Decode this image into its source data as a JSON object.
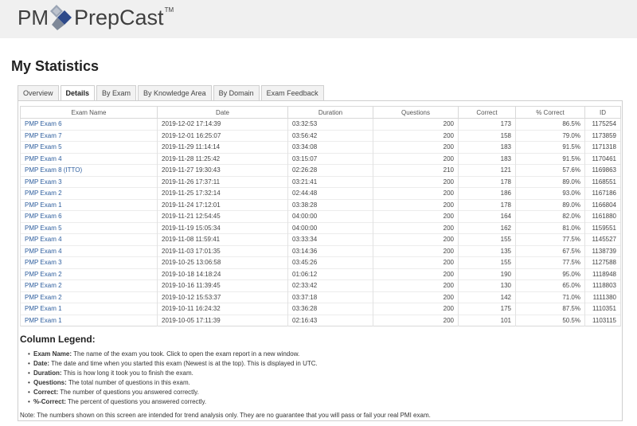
{
  "header": {
    "logo_pm": "PM",
    "logo_prep": "PrepCast",
    "logo_tm": "TM"
  },
  "page_title": "My Statistics",
  "tabs": [
    {
      "label": "Overview",
      "active": false
    },
    {
      "label": "Details",
      "active": true
    },
    {
      "label": "By Exam",
      "active": false
    },
    {
      "label": "By Knowledge Area",
      "active": false
    },
    {
      "label": "By Domain",
      "active": false
    },
    {
      "label": "Exam Feedback",
      "active": false
    }
  ],
  "table": {
    "columns": [
      "Exam Name",
      "Date",
      "Duration",
      "Questions",
      "Correct",
      "% Correct",
      "ID"
    ],
    "rows": [
      [
        "PMP Exam 6",
        "2019-12-02 17:14:39",
        "03:32:53",
        "200",
        "173",
        "86.5%",
        "1175254"
      ],
      [
        "PMP Exam 7",
        "2019-12-01 16:25:07",
        "03:56:42",
        "200",
        "158",
        "79.0%",
        "1173859"
      ],
      [
        "PMP Exam 5",
        "2019-11-29 11:14:14",
        "03:34:08",
        "200",
        "183",
        "91.5%",
        "1171318"
      ],
      [
        "PMP Exam 4",
        "2019-11-28 11:25:42",
        "03:15:07",
        "200",
        "183",
        "91.5%",
        "1170461"
      ],
      [
        "PMP Exam 8 (ITTO)",
        "2019-11-27 19:30:43",
        "02:26:28",
        "210",
        "121",
        "57.6%",
        "1169863"
      ],
      [
        "PMP Exam 3",
        "2019-11-26 17:37:11",
        "03:21:41",
        "200",
        "178",
        "89.0%",
        "1168551"
      ],
      [
        "PMP Exam 2",
        "2019-11-25 17:32:14",
        "02:44:48",
        "200",
        "186",
        "93.0%",
        "1167186"
      ],
      [
        "PMP Exam 1",
        "2019-11-24 17:12:01",
        "03:38:28",
        "200",
        "178",
        "89.0%",
        "1166804"
      ],
      [
        "PMP Exam 6",
        "2019-11-21 12:54:45",
        "04:00:00",
        "200",
        "164",
        "82.0%",
        "1161880"
      ],
      [
        "PMP Exam 5",
        "2019-11-19 15:05:34",
        "04:00:00",
        "200",
        "162",
        "81.0%",
        "1159551"
      ],
      [
        "PMP Exam 4",
        "2019-11-08 11:59:41",
        "03:33:34",
        "200",
        "155",
        "77.5%",
        "1145527"
      ],
      [
        "PMP Exam 4",
        "2019-11-03 17:01:35",
        "03:14:36",
        "200",
        "135",
        "67.5%",
        "1138739"
      ],
      [
        "PMP Exam 3",
        "2019-10-25 13:06:58",
        "03:45:26",
        "200",
        "155",
        "77.5%",
        "1127588"
      ],
      [
        "PMP Exam 2",
        "2019-10-18 14:18:24",
        "01:06:12",
        "200",
        "190",
        "95.0%",
        "1118948"
      ],
      [
        "PMP Exam 2",
        "2019-10-16 11:39:45",
        "02:33:42",
        "200",
        "130",
        "65.0%",
        "1118803"
      ],
      [
        "PMP Exam 2",
        "2019-10-12 15:53:37",
        "03:37:18",
        "200",
        "142",
        "71.0%",
        "1111380"
      ],
      [
        "PMP Exam 1",
        "2019-10-11 16:24:32",
        "03:36:28",
        "200",
        "175",
        "87.5%",
        "1110351"
      ],
      [
        "PMP Exam 1",
        "2019-10-05 17:11:39",
        "02:16:43",
        "200",
        "101",
        "50.5%",
        "1103115"
      ]
    ]
  },
  "legend": {
    "title": "Column Legend:",
    "items": [
      {
        "term": "Exam Name:",
        "desc": " The name of the exam you took. Click to open the exam report in a new window."
      },
      {
        "term": "Date:",
        "desc": " The date and time when you started this exam (Newest is at the top). This is displayed in UTC."
      },
      {
        "term": "Duration:",
        "desc": " This is how long it took you to finish the exam."
      },
      {
        "term": "Questions:",
        "desc": " The total number of questions in this exam."
      },
      {
        "term": "Correct:",
        "desc": " The number of questions you answered correctly."
      },
      {
        "term": "%-Correct:",
        "desc": " The percent of questions you answered correctly."
      }
    ],
    "note": "Note: The numbers shown on this screen are intended for trend analysis only. They are no guarantee that you will pass or fail your real PMI exam."
  }
}
